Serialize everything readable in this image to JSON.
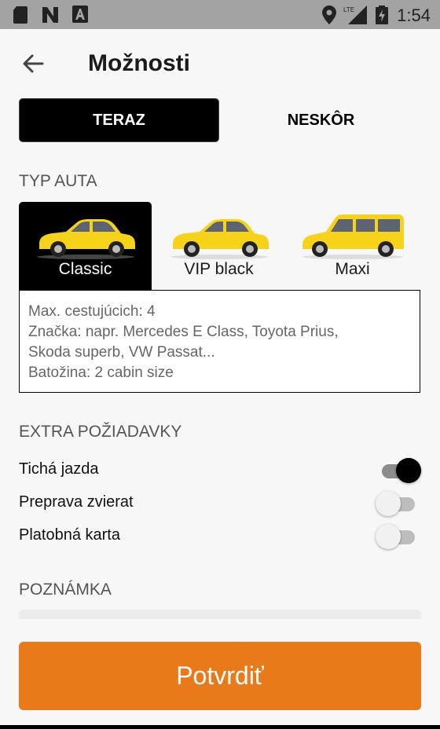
{
  "status_bar": {
    "time": "1:54",
    "network": "LTE"
  },
  "header": {
    "title": "Možnosti"
  },
  "time_toggle": {
    "now_label": "TERAZ",
    "later_label": "NESKÔR",
    "selected": "now"
  },
  "car_type": {
    "section_label": "TYP AUTA",
    "options": [
      {
        "label": "Classic",
        "selected": true
      },
      {
        "label": "VIP black",
        "selected": false
      },
      {
        "label": "Maxi",
        "selected": false
      }
    ],
    "details": {
      "line1": "Max. cestujúcich: 4",
      "line2": "Značka: napr. Mercedes E Class, Toyota Prius,",
      "line3": "Skoda superb, VW Passat...",
      "line4": "Batožina: 2 cabin size"
    }
  },
  "extras": {
    "section_label": "EXTRA POŽIADAVKY",
    "items": [
      {
        "label": "Tichá jazda",
        "enabled": true
      },
      {
        "label": "Preprava zvierat",
        "enabled": false
      },
      {
        "label": "Platobná karta",
        "enabled": false
      }
    ]
  },
  "note": {
    "section_label": "POZNÁMKA"
  },
  "confirm_button": {
    "label": "Potvrdiť"
  },
  "colors": {
    "accent": "#e97a1a",
    "car_yellow": "#f7d21a",
    "selected": "#000000"
  }
}
